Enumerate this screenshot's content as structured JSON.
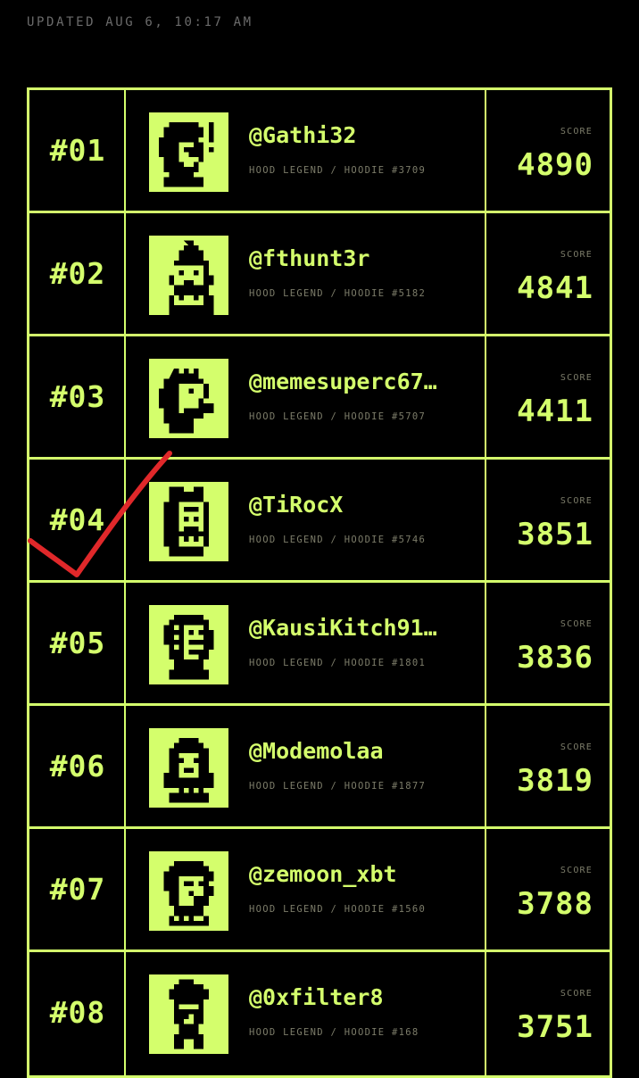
{
  "header": {
    "updated_text": "UPDATED AUG 6, 10:17 AM"
  },
  "colors": {
    "accent": "#d4fe6c",
    "background": "#000000",
    "muted_text": "#7d7d6a",
    "annotation": "#e0282a"
  },
  "leaderboard": {
    "score_label": "SCORE",
    "rows": [
      {
        "rank": "#01",
        "username": "@Gathi32",
        "subtitle": "HOOD LEGEND / HOODIE #3709",
        "score": "4890",
        "avatar_icon": "pixel-avatar-icon"
      },
      {
        "rank": "#02",
        "username": "@fthunt3r",
        "subtitle": "HOOD LEGEND / HOODIE #5182",
        "score": "4841",
        "avatar_icon": "pixel-avatar-icon"
      },
      {
        "rank": "#03",
        "username": "@memesuperc67…",
        "subtitle": "HOOD LEGEND / HOODIE #5707",
        "score": "4411",
        "avatar_icon": "pixel-avatar-icon"
      },
      {
        "rank": "#04",
        "username": "@TiRocX",
        "subtitle": "HOOD LEGEND / HOODIE #5746",
        "score": "3851",
        "avatar_icon": "pixel-avatar-icon"
      },
      {
        "rank": "#05",
        "username": "@KausiKitch91…",
        "subtitle": "HOOD LEGEND / HOODIE #1801",
        "score": "3836",
        "avatar_icon": "pixel-avatar-icon"
      },
      {
        "rank": "#06",
        "username": "@Modemolaa",
        "subtitle": "HOOD LEGEND / HOODIE #1877",
        "score": "3819",
        "avatar_icon": "pixel-avatar-icon"
      },
      {
        "rank": "#07",
        "username": "@zemoon_xbt",
        "subtitle": "HOOD LEGEND / HOODIE #1560",
        "score": "3788",
        "avatar_icon": "pixel-avatar-icon"
      },
      {
        "rank": "#08",
        "username": "@0xfilter8",
        "subtitle": "HOOD LEGEND / HOODIE #168",
        "score": "3751",
        "avatar_icon": "pixel-avatar-icon"
      }
    ]
  },
  "annotation": {
    "icon": "red-checkmark-icon"
  }
}
